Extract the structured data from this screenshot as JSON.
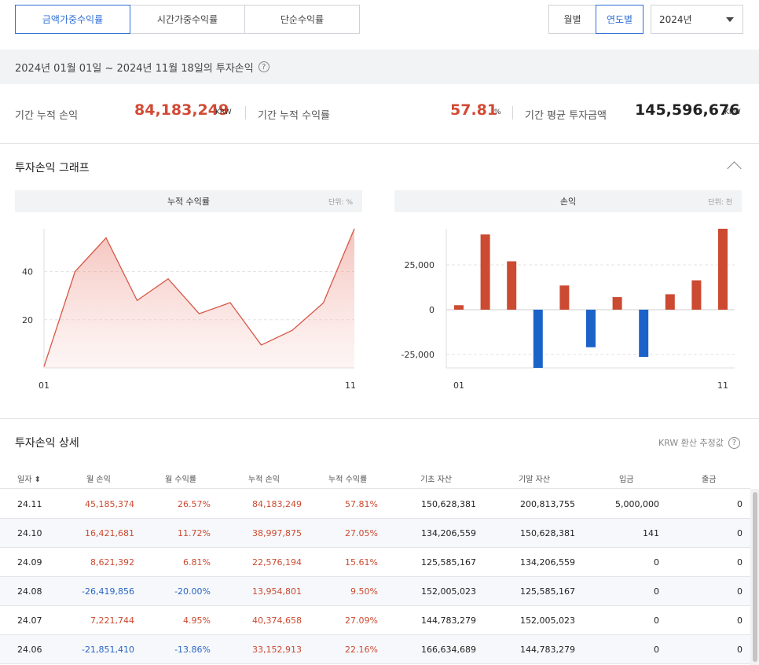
{
  "tabs": [
    {
      "label": "금액가중수익률",
      "active": true
    },
    {
      "label": "시간가중수익률",
      "active": false
    },
    {
      "label": "단순수익률",
      "active": false
    }
  ],
  "view_toggle": [
    {
      "label": "월별",
      "active": false
    },
    {
      "label": "연도별",
      "active": true
    }
  ],
  "year_select": {
    "value": "2024년"
  },
  "period": {
    "text": "2024년 01월 01일 ~ 2024년 11월 18일의 투자손익",
    "help": "?"
  },
  "summary": {
    "cum_profit_label": "기간 누적 손익",
    "cum_profit_value": "84,183,249",
    "cum_profit_unit": "KRW",
    "cum_return_label": "기간 누적 수익률",
    "cum_return_value": "57.81",
    "cum_return_unit": "%",
    "avg_invest_label": "기간 평균 투자금액",
    "avg_invest_value": "145,596,676",
    "avg_invest_unit": "KRW"
  },
  "graph_section": {
    "title": "투자손익 그래프"
  },
  "chart_data": [
    {
      "type": "area",
      "title": "누적 수익률",
      "unit_label": "단위: %",
      "x_tick_labels": [
        "01",
        "11"
      ],
      "y_tick_labels": [
        "20",
        "40"
      ],
      "x": [
        1,
        2,
        3,
        4,
        5,
        6,
        7,
        8,
        9,
        10,
        11
      ],
      "values": [
        0.5,
        40,
        54,
        28,
        37,
        22.5,
        27.1,
        9.5,
        15.6,
        27.0,
        57.8
      ],
      "ylim": [
        0,
        57.8
      ]
    },
    {
      "type": "bar",
      "title": "손익",
      "unit_label": "단위: 천",
      "x_tick_labels": [
        "01",
        "11"
      ],
      "y_tick_labels": [
        "25,000",
        "0",
        "-25,000"
      ],
      "x": [
        1,
        2,
        3,
        4,
        5,
        6,
        7,
        8,
        9,
        10,
        11
      ],
      "values": [
        2500,
        42000,
        27000,
        -32500,
        13500,
        -21000,
        7000,
        -26400,
        8600,
        16400,
        45200
      ],
      "ylim": [
        -32500,
        45200
      ],
      "colors": {
        "positive": "#cc4a31",
        "negative": "#1c63c9"
      }
    }
  ],
  "detail": {
    "title": "투자손익 상세",
    "note": "KRW 환산 추정값",
    "columns": [
      "일자 ⬍",
      "월 손익",
      "월 수익률",
      "누적 손익",
      "누적 수익률",
      "기초 자산",
      "기말 자산",
      "입금",
      "출금"
    ],
    "rows": [
      {
        "date": "24.11",
        "m_profit": "45,185,374",
        "m_return": "26.57%",
        "c_profit": "84,183,249",
        "c_return": "57.81%",
        "begin": "150,628,381",
        "end": "200,813,755",
        "deposit": "5,000,000",
        "withdraw": "0",
        "m_sign": "pos",
        "c_sign": "pos"
      },
      {
        "date": "24.10",
        "m_profit": "16,421,681",
        "m_return": "11.72%",
        "c_profit": "38,997,875",
        "c_return": "27.05%",
        "begin": "134,206,559",
        "end": "150,628,381",
        "deposit": "141",
        "withdraw": "0",
        "m_sign": "pos",
        "c_sign": "pos"
      },
      {
        "date": "24.09",
        "m_profit": "8,621,392",
        "m_return": "6.81%",
        "c_profit": "22,576,194",
        "c_return": "15.61%",
        "begin": "125,585,167",
        "end": "134,206,559",
        "deposit": "0",
        "withdraw": "0",
        "m_sign": "pos",
        "c_sign": "pos"
      },
      {
        "date": "24.08",
        "m_profit": "-26,419,856",
        "m_return": "-20.00%",
        "c_profit": "13,954,801",
        "c_return": "9.50%",
        "begin": "152,005,023",
        "end": "125,585,167",
        "deposit": "0",
        "withdraw": "0",
        "m_sign": "neg",
        "c_sign": "pos"
      },
      {
        "date": "24.07",
        "m_profit": "7,221,744",
        "m_return": "4.95%",
        "c_profit": "40,374,658",
        "c_return": "27.09%",
        "begin": "144,783,279",
        "end": "152,005,023",
        "deposit": "0",
        "withdraw": "0",
        "m_sign": "pos",
        "c_sign": "pos"
      },
      {
        "date": "24.06",
        "m_profit": "-21,851,410",
        "m_return": "-13.86%",
        "c_profit": "33,152,913",
        "c_return": "22.16%",
        "begin": "166,634,689",
        "end": "144,783,279",
        "deposit": "0",
        "withdraw": "0",
        "m_sign": "neg",
        "c_sign": "pos"
      }
    ]
  }
}
